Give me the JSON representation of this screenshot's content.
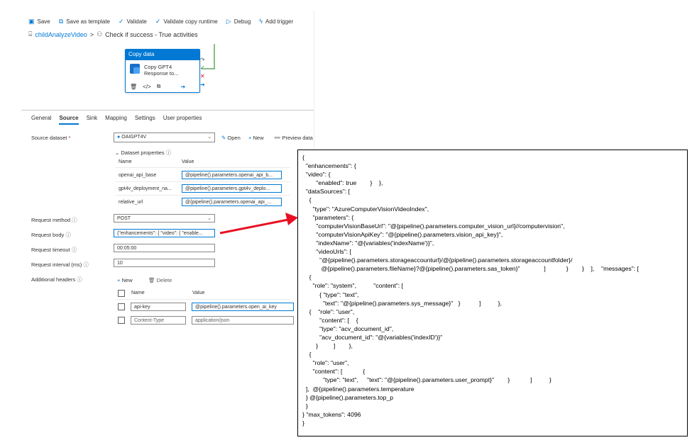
{
  "toolbar": {
    "items": [
      {
        "icon": "save-icon",
        "label": "Save"
      },
      {
        "icon": "template-icon",
        "label": "Save as template"
      },
      {
        "icon": "check-icon",
        "label": "Validate"
      },
      {
        "icon": "check-icon",
        "label": "Validate copy runtime"
      },
      {
        "icon": "play-icon",
        "label": "Debug"
      },
      {
        "icon": "trigger-icon",
        "label": "Add trigger"
      }
    ]
  },
  "breadcrumb": {
    "pipeline": "childAnalyzeVideo",
    "separator": ">",
    "current": "Check if success - True activities"
  },
  "activity": {
    "header": "Copy data",
    "name_line1": "Copy GPT4",
    "name_line2": "Response to..."
  },
  "tabs": [
    "General",
    "Source",
    "Sink",
    "Mapping",
    "Settings",
    "User properties"
  ],
  "active_tab": "Source",
  "source": {
    "dataset_label": "Source dataset",
    "required_mark": "*",
    "dataset_value": "OAIGPT4V",
    "open": "Open",
    "new": "New",
    "preview": "Preview data",
    "dataset_props_title": "Dataset properties",
    "col_name": "Name",
    "col_value": "Value",
    "props": [
      {
        "name": "openai_api_base",
        "value": "@pipeline().parameters.openai_api_b..."
      },
      {
        "name": "gpt4v_deployment_na...",
        "value": "@pipeline().parameters.gpt4v_deplo..."
      },
      {
        "name": "relative_url",
        "value": "@{pipeline().parameters.openai_api_..."
      }
    ],
    "request_method_label": "Request method",
    "request_method": "POST",
    "request_body_label": "Request body",
    "request_body": "{\"enhancements\": { \"video\": { \"enable...",
    "request_timeout_label": "Request timeout",
    "request_timeout": "00:05:00",
    "request_interval_label": "Request interval (ms)",
    "request_interval": "10",
    "additional_headers_label": "Additional headers",
    "headers_new": "New",
    "headers_delete": "Delete",
    "headers_col_name": "Name",
    "headers_col_value": "Value",
    "headers": [
      {
        "name": "api-key",
        "value": "@pipeline().parameters.open_ai_key"
      },
      {
        "name": "Content-Type",
        "value": "application/json"
      }
    ]
  },
  "code_lines": [
    "{",
    "  \"enhancements\": {",
    "  \"video\": {",
    "        \"enabled\": true        }    },",
    "  \"dataSources\": [",
    "    {",
    "      \"type\": \"AzureComputerVisionVideoIndex\",",
    "      \"parameters\": {",
    "        \"computerVisionBaseUrl\": \"@{pipeline().parameters.computer_vision_url}//computervision\",",
    "        \"computerVisionApiKey\": \"@{pipeline().parameters.vision_api_key}\",",
    "        \"indexName\": \"@{variables('indexName')}\",",
    "        \"videoUrls\": [",
    "          \"@{pipeline().parameters.storageaccounturl}/@{pipeline().parameters.storageaccountfolder}/",
    "           @{pipeline().parameters.fileName}?@{pipeline().parameters.sas_token}\"              ]            }        }    ],    \"messages\": [",
    "    {",
    "      \"role\": \"system\",          \"content\": [",
    "          { \"type\": \"text\",",
    "            \"text\": \"@{pipeline().parameters.sys_message}\"   }           ]          },",
    "    {    \"role\": \"user\",",
    "          \"content\": [    {",
    "          \"type\": \"acv_document_id\",",
    "          \"acv_document_id\": \"@{variables('indexID')}\"",
    "        }         ]        },",
    "    {",
    "      \"role\": \"user\",",
    "      \"content\": [            {",
    "            \"type\": \"text\",     \"text\": \"@{pipeline().parameters.user_prompt}\"        }            ]          }",
    "  ],  @{pipeline().parameters.temperature",
    "  } @{pipeline().parameters.top_p",
    "  }",
    "} \"max_tokens\": 4096",
    "}"
  ],
  "colors": {
    "accent": "#0078d4",
    "arrow": "#e81123",
    "success": "#107c10"
  }
}
